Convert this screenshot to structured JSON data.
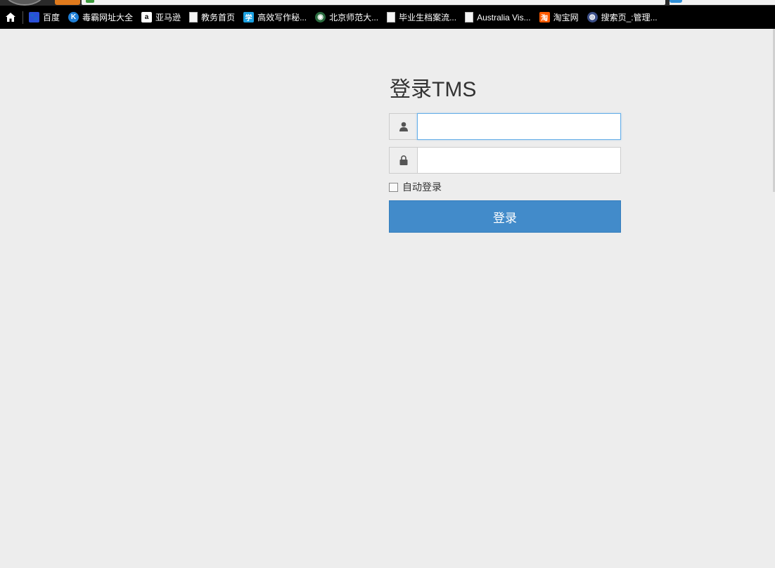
{
  "bookmarks": [
    {
      "label": "百度",
      "icon": "baidu-paw-icon",
      "glyph": "🐾"
    },
    {
      "label": "毒霸网址大全",
      "icon": "k-circle-icon",
      "glyph": "K"
    },
    {
      "label": "亚马逊",
      "icon": "amazon-icon",
      "glyph": "a"
    },
    {
      "label": "教务首页",
      "icon": "page-icon",
      "glyph": ""
    },
    {
      "label": "高效写作秘...",
      "icon": "xue-icon",
      "glyph": "学"
    },
    {
      "label": "北京师范大...",
      "icon": "bnu-seal-icon",
      "glyph": "◉"
    },
    {
      "label": "毕业生档案流...",
      "icon": "page-icon",
      "glyph": ""
    },
    {
      "label": "Australia Vis...",
      "icon": "page-icon",
      "glyph": ""
    },
    {
      "label": "淘宝网",
      "icon": "taobao-icon",
      "glyph": "淘"
    },
    {
      "label": "搜索页_:管理...",
      "icon": "globe-icon",
      "glyph": "◍"
    }
  ],
  "login": {
    "title": "登录TMS",
    "username": {
      "value": "",
      "placeholder": ""
    },
    "password": {
      "value": "",
      "placeholder": ""
    },
    "remember_label": "自动登录",
    "remember_checked": false,
    "submit_label": "登录"
  },
  "colors": {
    "page_bg": "#ededed",
    "primary_button": "#428bca",
    "bookmark_bar_bg": "#000000"
  }
}
